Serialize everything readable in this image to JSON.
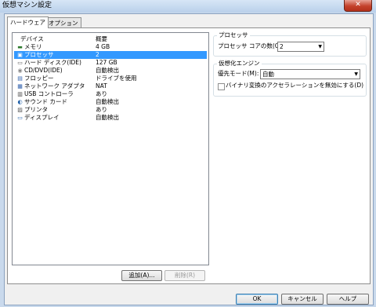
{
  "window": {
    "title": "仮想マシン設定",
    "close_glyph": "✕"
  },
  "tabs": [
    {
      "label": "ハードウェア",
      "active": true
    },
    {
      "label": "オプション",
      "active": false
    }
  ],
  "device_list": {
    "columns": {
      "device": "デバイス",
      "summary": "概要"
    },
    "rows": [
      {
        "name": "メモリ",
        "value": "4 GB",
        "icon": "memory-icon",
        "glyph": "▬",
        "color": "#2d7a2d"
      },
      {
        "name": "プロセッサ",
        "value": "2",
        "icon": "processor-icon",
        "glyph": "▣",
        "color": "#1f5fa8",
        "selected": true
      },
      {
        "name": "ハード ディスク(IDE)",
        "value": "127 GB",
        "icon": "hard-disk-icon",
        "glyph": "▭",
        "color": "#555555"
      },
      {
        "name": "CD/DVD(IDE)",
        "value": "自動検出",
        "icon": "cd-dvd-icon",
        "glyph": "◉",
        "color": "#888888"
      },
      {
        "name": "フロッピー",
        "value": "ドライブを使用",
        "icon": "floppy-icon",
        "glyph": "▤",
        "color": "#2a5caa"
      },
      {
        "name": "ネットワーク アダプタ",
        "value": "NAT",
        "icon": "network-adapter-icon",
        "glyph": "▦",
        "color": "#2a5caa"
      },
      {
        "name": "USB コントローラ",
        "value": "あり",
        "icon": "usb-icon",
        "glyph": "▥",
        "color": "#444444"
      },
      {
        "name": "サウンド カード",
        "value": "自動検出",
        "icon": "sound-card-icon",
        "glyph": "◐",
        "color": "#1f5fa8"
      },
      {
        "name": "プリンタ",
        "value": "あり",
        "icon": "printer-icon",
        "glyph": "▨",
        "color": "#555555"
      },
      {
        "name": "ディスプレイ",
        "value": "自動検出",
        "icon": "display-icon",
        "glyph": "▭",
        "color": "#1f5fa8"
      }
    ],
    "add_button": "追加(A)...",
    "remove_button": "削除(R)"
  },
  "processor": {
    "group_title": "プロセッサ",
    "cores_label": "プロセッサ コアの数(C):",
    "cores_value": "2"
  },
  "virtualization": {
    "group_title": "仮想化エンジン",
    "mode_label": "優先モード(M):",
    "mode_value": "自動",
    "disable_accel_label": "バイナリ変換のアクセラレーションを無効にする(D)",
    "disable_accel_checked": false
  },
  "footer": {
    "ok": "OK",
    "cancel": "キャンセル",
    "help": "ヘルプ"
  }
}
